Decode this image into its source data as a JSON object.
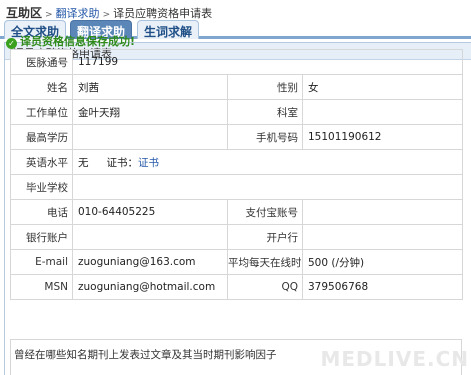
{
  "breadcrumb": {
    "home": "互助区",
    "section": "翻译求助",
    "current": "译员应聘资格申请表"
  },
  "tabs": [
    {
      "label": "全文求助",
      "active": false
    },
    {
      "label": "翻译求助",
      "active": true
    },
    {
      "label": "生词求解",
      "active": false
    }
  ],
  "panel": {
    "title": "译员应聘资格申请表"
  },
  "success_message": "译员资格信息保存成功!",
  "form": {
    "member_id_label": "医脉通号",
    "member_id": "117199",
    "name_label": "姓名",
    "name": "刘茜",
    "gender_label": "性别",
    "gender": "女",
    "employer_label": "工作单位",
    "employer": "金叶天翔",
    "department_label": "科室",
    "department": "",
    "education_label": "最高学历",
    "education": "",
    "mobile_label": "手机号码",
    "mobile": "15101190612",
    "english_label": "英语水平",
    "english": "无",
    "certificate_label": "证书：",
    "certificate_link": "证书",
    "school_label": "毕业学校",
    "school": "",
    "phone_label": "电话",
    "phone": "010-64405225",
    "alipay_label": "支付宝账号",
    "alipay": "",
    "bank_label": "银行账户",
    "bank": "",
    "bank_branch_label": "开户行",
    "bank_branch": "",
    "email_label": "E-mail",
    "email": "zuoguniang@163.com",
    "speed_label": "平均每天在线时间",
    "speed": "500 (/分钟)",
    "msn_label": "MSN",
    "msn": "zuoguniang@hotmail.com",
    "qq_label": "QQ",
    "qq": "379506768",
    "publications_label": "曾经在哪些知名期刊上发表过文章及其当时期刊影响因子"
  },
  "watermark": "MEDLIVE.CN",
  "colors": {
    "accent": "#5a86b8",
    "link": "#2458a8",
    "success": "#2f8a1a"
  }
}
